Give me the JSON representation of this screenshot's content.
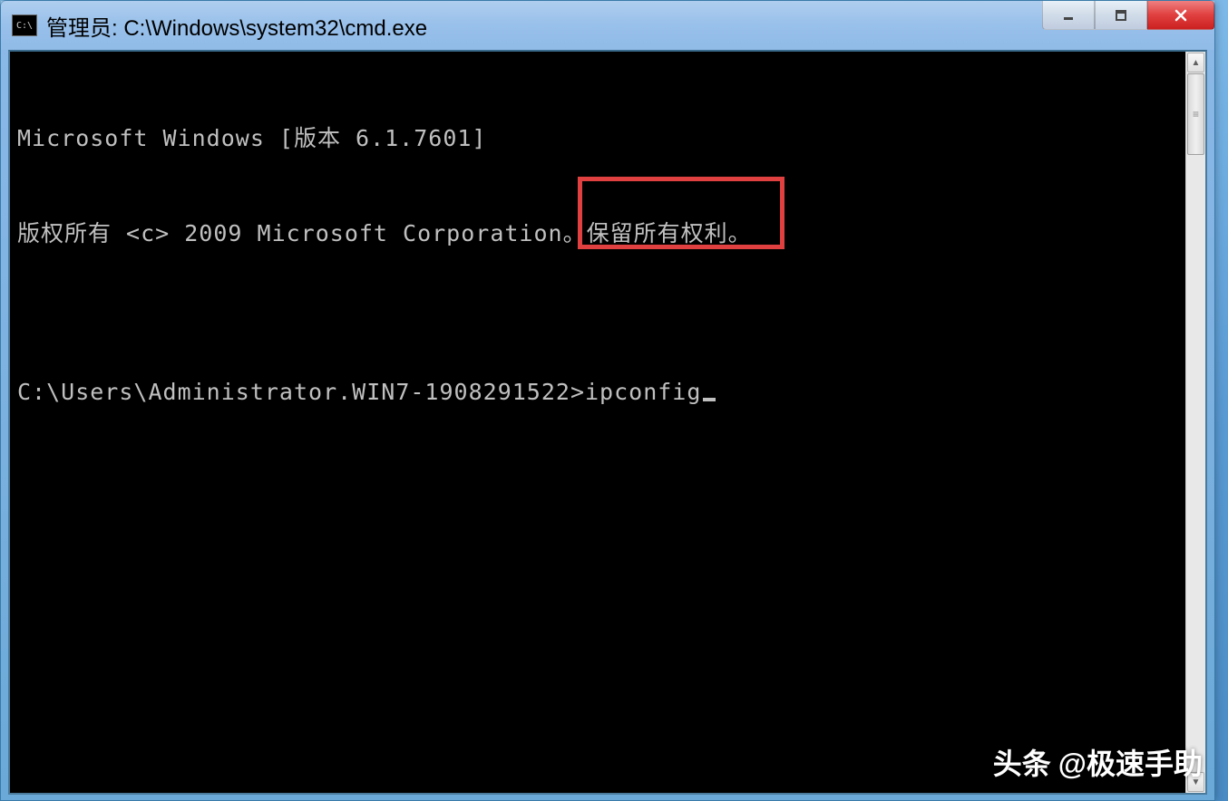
{
  "window": {
    "title": "管理员: C:\\Windows\\system32\\cmd.exe",
    "icon_label": "C:\\"
  },
  "console": {
    "line1": "Microsoft Windows [版本 6.1.7601]",
    "line2": "版权所有 <c> 2009 Microsoft Corporation。保留所有权利。",
    "blank": "",
    "prompt": "C:\\Users\\Administrator.WIN7-1908291522>",
    "command": "ipconfig"
  },
  "watermark": {
    "label": "头条",
    "author": "@极速手助"
  },
  "controls": {
    "minimize": "minimize",
    "maximize": "maximize",
    "close": "close"
  }
}
